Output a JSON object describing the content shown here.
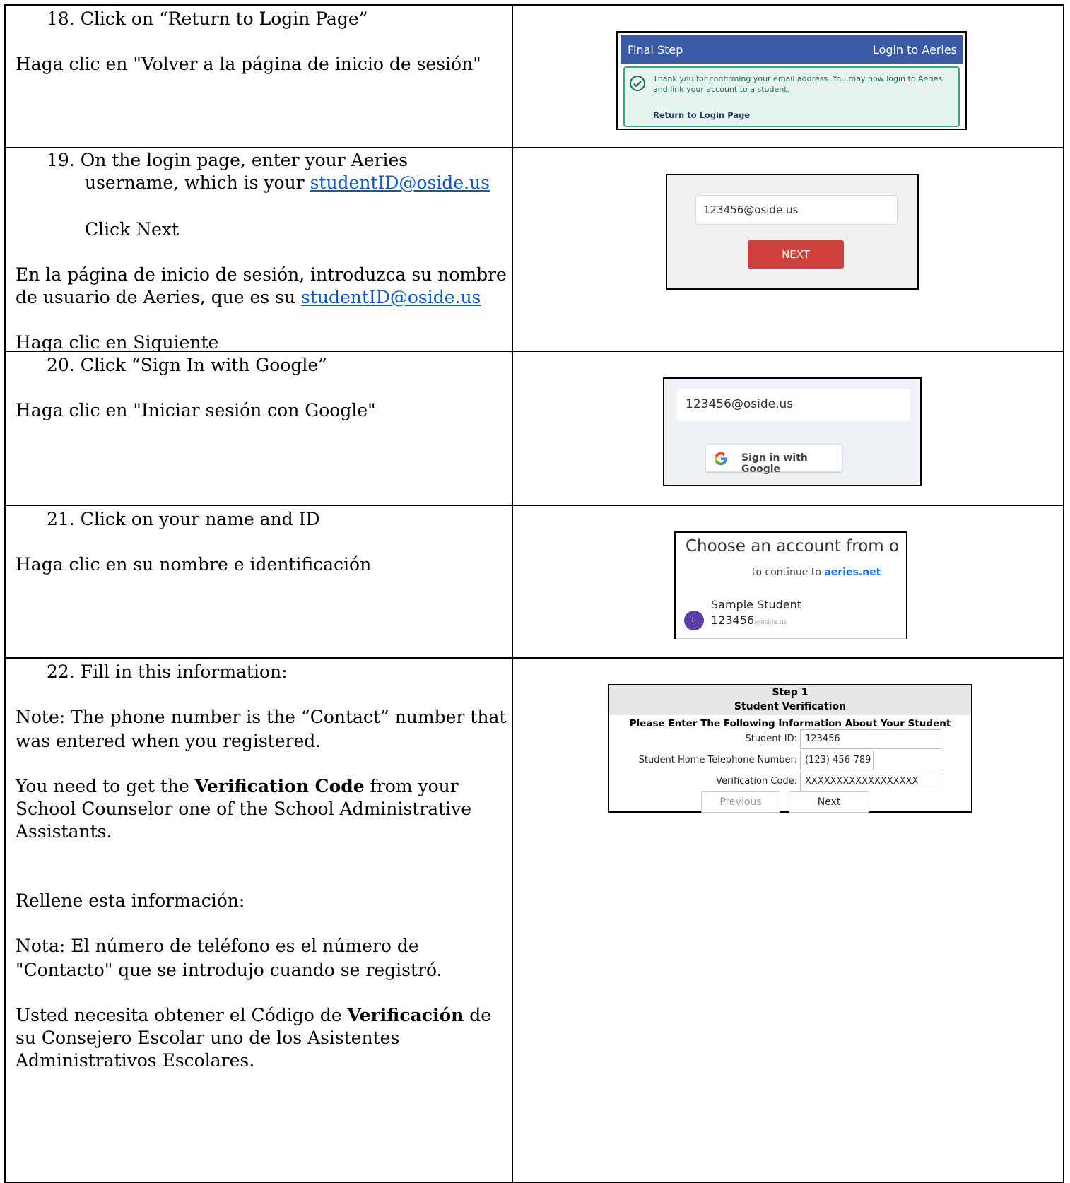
{
  "steps": [
    {
      "number": "18.",
      "text": "Click on “Return to Login Page”",
      "spanish": "Haga clic en \"Volver a la página de inicio de sesión\"",
      "screenshot": {
        "header_left": "Final Step",
        "header_right": "Login to Aeries",
        "message": "Thank you for confirming your email address. You may now login to Aeries and link your account to a student.",
        "link": "Return to Login Page",
        "accent_color": "#3b5ba5"
      }
    },
    {
      "number": "19.",
      "text_line1": "On the login page, enter your Aeries",
      "text_line2": "username, which is your ",
      "link": "studentID@oside.us",
      "click": "Click Next",
      "spanish_line1": "En la página de inicio de sesión, introduzca su nombre",
      "spanish_line2": "de usuario de Aeries, que es su ",
      "spanish_link": "studentID@oside.us",
      "spanish_click": "Haga clic en Siguiente",
      "screenshot": {
        "input_value": "123456@oside.us",
        "button": "NEXT",
        "button_color": "#cf3f3c"
      }
    },
    {
      "number": "20.",
      "text": "Click “Sign In with Google”",
      "spanish": "Haga clic en \"Iniciar sesión con Google\"",
      "screenshot": {
        "input_value": "123456@oside.us",
        "button": "Sign in with Google",
        "icon": "google-g-icon"
      }
    },
    {
      "number": "21.",
      "text": "Click on your name and ID",
      "spanish": "Haga clic en su nombre e identificación",
      "screenshot": {
        "title": "Choose an account from o",
        "subtitle_prefix": "to continue to ",
        "subtitle_link": "aeries.net",
        "avatar_letter": "L",
        "name": "Sample Student",
        "id": "123456",
        "id_domain": "@oside.us"
      }
    },
    {
      "number": "22.",
      "text": "Fill in this information:",
      "note_line1": "Note: The phone number is the “Contact” number that",
      "note_line2": "was entered when you registered.",
      "need_prefix": "You need to get the ",
      "need_bold": "Verification Code",
      "need_suffix": " from your",
      "need_line2": "School Counselor one of the School Administrative",
      "need_line3": "Assistants.",
      "es_fill": "Rellene esta información:",
      "es_note_line1": "Nota: El número de teléfono es el número de",
      "es_note_line2": "\"Contacto\" que se introdujo cuando se registró.",
      "es_need_prefix": "Usted necesita obtener el Código de ",
      "es_need_bold": "Verificación",
      "es_need_suffix": " de",
      "es_need_line2": "su Consejero Escolar uno de los Asistentes",
      "es_need_line3": "Administrativos Escolares.",
      "screenshot": {
        "step": "Step 1",
        "heading": "Student Verification",
        "intro": "Please Enter The Following Information About Your Student",
        "fields": [
          {
            "label": "Student ID:",
            "value": "123456"
          },
          {
            "label": "Student Home Telephone Number:",
            "value": "(123) 456-789"
          },
          {
            "label": "Verification Code:",
            "value": "XXXXXXXXXXXXXXXXXX"
          }
        ],
        "previous": "Previous",
        "next": "Next"
      }
    }
  ]
}
